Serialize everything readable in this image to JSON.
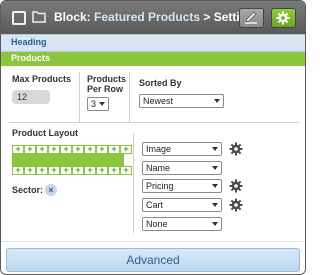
{
  "titlebar": {
    "prefix": "Block: ",
    "block_name": "Featured Products",
    "suffix": " > Settings"
  },
  "sections": {
    "heading": "Heading",
    "products": "Products"
  },
  "fields": {
    "max_products_label": "Max Products",
    "max_products_value": "12",
    "per_row_label_1": "Products",
    "per_row_label_2": "Per Row",
    "per_row_value": "3",
    "sorted_by_label": "Sorted By",
    "sorted_by_value": "Newest"
  },
  "layout": {
    "label": "Product Layout",
    "sector_label": "Sector:",
    "grid_columns": 10,
    "rows": [
      "Image",
      "Name",
      "Pricing",
      "Cart",
      "None"
    ]
  },
  "advanced_label": "Advanced",
  "icons": {
    "titlebar": [
      "checkbox-icon",
      "folder-icon",
      "pencil-icon",
      "gear-icon"
    ],
    "row_settings": [
      "gear-icon"
    ],
    "sector": "close-icon"
  },
  "colors": {
    "accent_green": "#8cc63f",
    "heading_blue": "#d8e6f3",
    "titlebar_gray": "#6a6a6a"
  }
}
